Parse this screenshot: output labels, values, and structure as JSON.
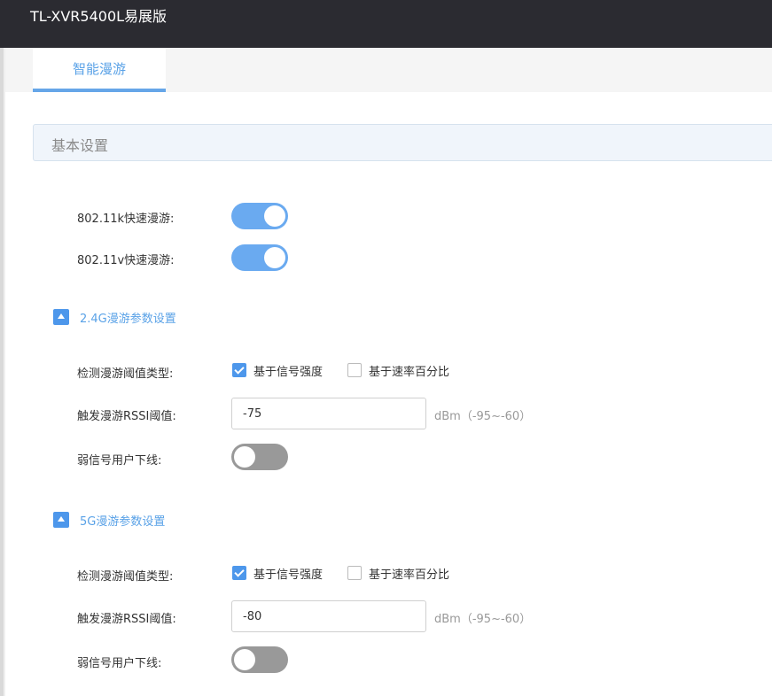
{
  "app": {
    "title": "TL-XVR5400L易展版"
  },
  "tabs": [
    {
      "label": "智能漫游",
      "active": true
    }
  ],
  "section": {
    "title": "基本设置"
  },
  "fast_roaming": {
    "k_label": "802.11k快速漫游:",
    "k_enabled": true,
    "v_label": "802.11v快速漫游:",
    "v_enabled": true
  },
  "band_24g": {
    "title": "2.4G漫游参数设置",
    "threshold_type_label": "检测漫游阈值类型:",
    "opt_signal": "基于信号强度",
    "opt_signal_checked": true,
    "opt_rate": "基于速率百分比",
    "opt_rate_checked": false,
    "rssi_label": "触发漫游RSSI阈值:",
    "rssi_value": "-75",
    "rssi_unit": "dBm（-95~-60）",
    "weak_label": "弱信号用户下线:",
    "weak_enabled": false
  },
  "band_5g": {
    "title": "5G漫游参数设置",
    "threshold_type_label": "检测漫游阈值类型:",
    "opt_signal": "基于信号强度",
    "opt_signal_checked": true,
    "opt_rate": "基于速率百分比",
    "opt_rate_checked": false,
    "rssi_label": "触发漫游RSSI阈值:",
    "rssi_value": "-80",
    "rssi_unit": "dBm（-95~-60）",
    "weak_label": "弱信号用户下线:",
    "weak_enabled": false
  },
  "colors": {
    "topbar": "#2b2b31",
    "accent": "#4d97eb",
    "toggle_on": "#6aaaf0",
    "toggle_off": "#999999"
  }
}
